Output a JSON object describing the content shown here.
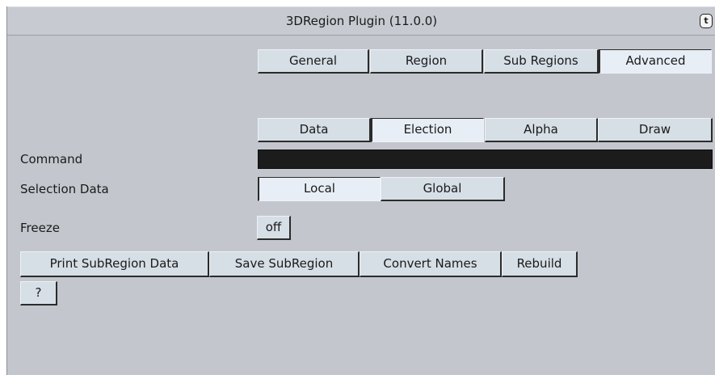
{
  "title": "3DRegion Plugin (11.0.0)",
  "corner_icon": "script-tag-icon",
  "tabs_main": [
    "General",
    "Region",
    "Sub Regions",
    "Advanced"
  ],
  "tabs_main_active": "Advanced",
  "tabs_sub": [
    "Data",
    "Election",
    "Alpha",
    "Draw"
  ],
  "tabs_sub_active": "Election",
  "fields": {
    "command_label": "Command",
    "command_value": "",
    "selection_label": "Selection Data",
    "selection_options": [
      "Local",
      "Global"
    ],
    "selection_active": "Local",
    "freeze_label": "Freeze",
    "freeze_value": "off"
  },
  "actions": [
    "Print SubRegion Data",
    "Save SubRegion",
    "Convert Names",
    "Rebuild"
  ],
  "help_label": "?"
}
